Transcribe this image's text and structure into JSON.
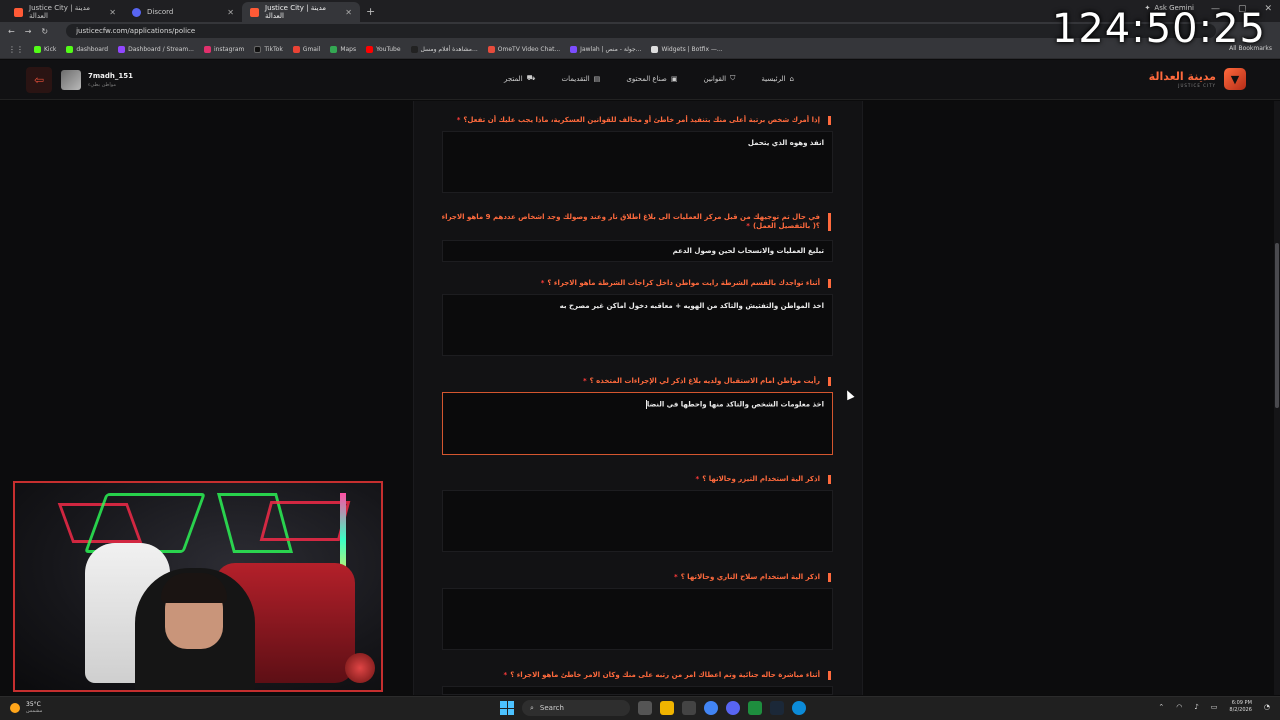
{
  "browser": {
    "tabs": [
      {
        "title": "Justice City | مدينة العدالة",
        "active": false,
        "icon": "justice-favicon"
      },
      {
        "title": "Discord",
        "active": false,
        "icon": "discord-favicon"
      },
      {
        "title": "Justice City | مدينة العدالة",
        "active": true,
        "icon": "justice-favicon"
      }
    ],
    "ask_gemini": "Ask Gemini",
    "url": "justicecfw.com/applications/police",
    "bookmarks": [
      "Kick",
      "dashboard",
      "Dashboard / Stream...",
      "instagram",
      "TikTok",
      "Gmail",
      "Maps",
      "YouTube",
      "مشاهدة أفلام ومسل...",
      "OmeTV Video Chat...",
      "Jawlah | جولة - منص...",
      "Widgets | Botfix —..."
    ],
    "all_bookmarks": "All Bookmarks"
  },
  "clock_overlay": "124:50:25",
  "site": {
    "user": {
      "name": "7madh_151",
      "role": "مواطن بطيء"
    },
    "nav": [
      {
        "label": "الرئيسية",
        "icon": "home-icon"
      },
      {
        "label": "القوانين",
        "icon": "shield-icon"
      },
      {
        "label": "صناع المحتوى",
        "icon": "video-icon"
      },
      {
        "label": "التقديمات",
        "icon": "document-icon"
      },
      {
        "label": "المتجر",
        "icon": "cart-icon"
      }
    ],
    "brand": {
      "name": "مدينة العدالة",
      "sub": "JUSTICE CITY"
    }
  },
  "form": {
    "questions": [
      {
        "question": "إذا أمرك شخص برتبة أعلى منك بتنفيذ أمر خاطئ أو مخالف للقوانين العسكرية، ماذا يجب عليك أن تفعل؟",
        "answer": "انفذ وهوه الذي يتحمل"
      },
      {
        "question": "في حال تم توجيهك من قبل مركز العمليات الى بلاغ اطلاق نار وعند وصولك وجد اشخاص عددهم 9 ماهو الاجراء ؟( بالتفصيل العمل)",
        "answer": "تبليغ العمليات والانسحاب لحين وصول الدعم"
      },
      {
        "question": "أثناء تواجدك بالقسم الشرطة رايت مواطن داخل كراجات الشرطة ماهو الاجراء ؟",
        "answer": "اخذ المواطن والتفتيش والتاكد من الهويه + معاقبه دخول اماكن غير مصرح به"
      },
      {
        "question": "رأيت مواطن امام الاستقبال ولديه بلاغ اذكر لي الإجراءات المتخذه ؟",
        "answer": "اخذ معلومات الشخص والتاكد منها واحطها في النضا"
      },
      {
        "question": "اذكر الية استخدام التيزر وحالاتها ؟",
        "answer": ""
      },
      {
        "question": "اذكر الية استخدام سلاح الناري وحالاتها ؟",
        "answer": ""
      },
      {
        "question": "أثناء مباشرة حاله جنائية وتم اعطاك امر من رتبه على منك وكان الامر خاطئ ماهو الاجراء ؟",
        "answer": ""
      }
    ]
  },
  "taskbar": {
    "weather_temp": "35°C",
    "weather_desc": "مشمس",
    "search": "Search",
    "time": "6:09 PM",
    "date": "8/2/2026"
  },
  "colors": {
    "accent": "#ff6a3d",
    "required": "#ff3b3b",
    "focus": "#d4562f"
  }
}
